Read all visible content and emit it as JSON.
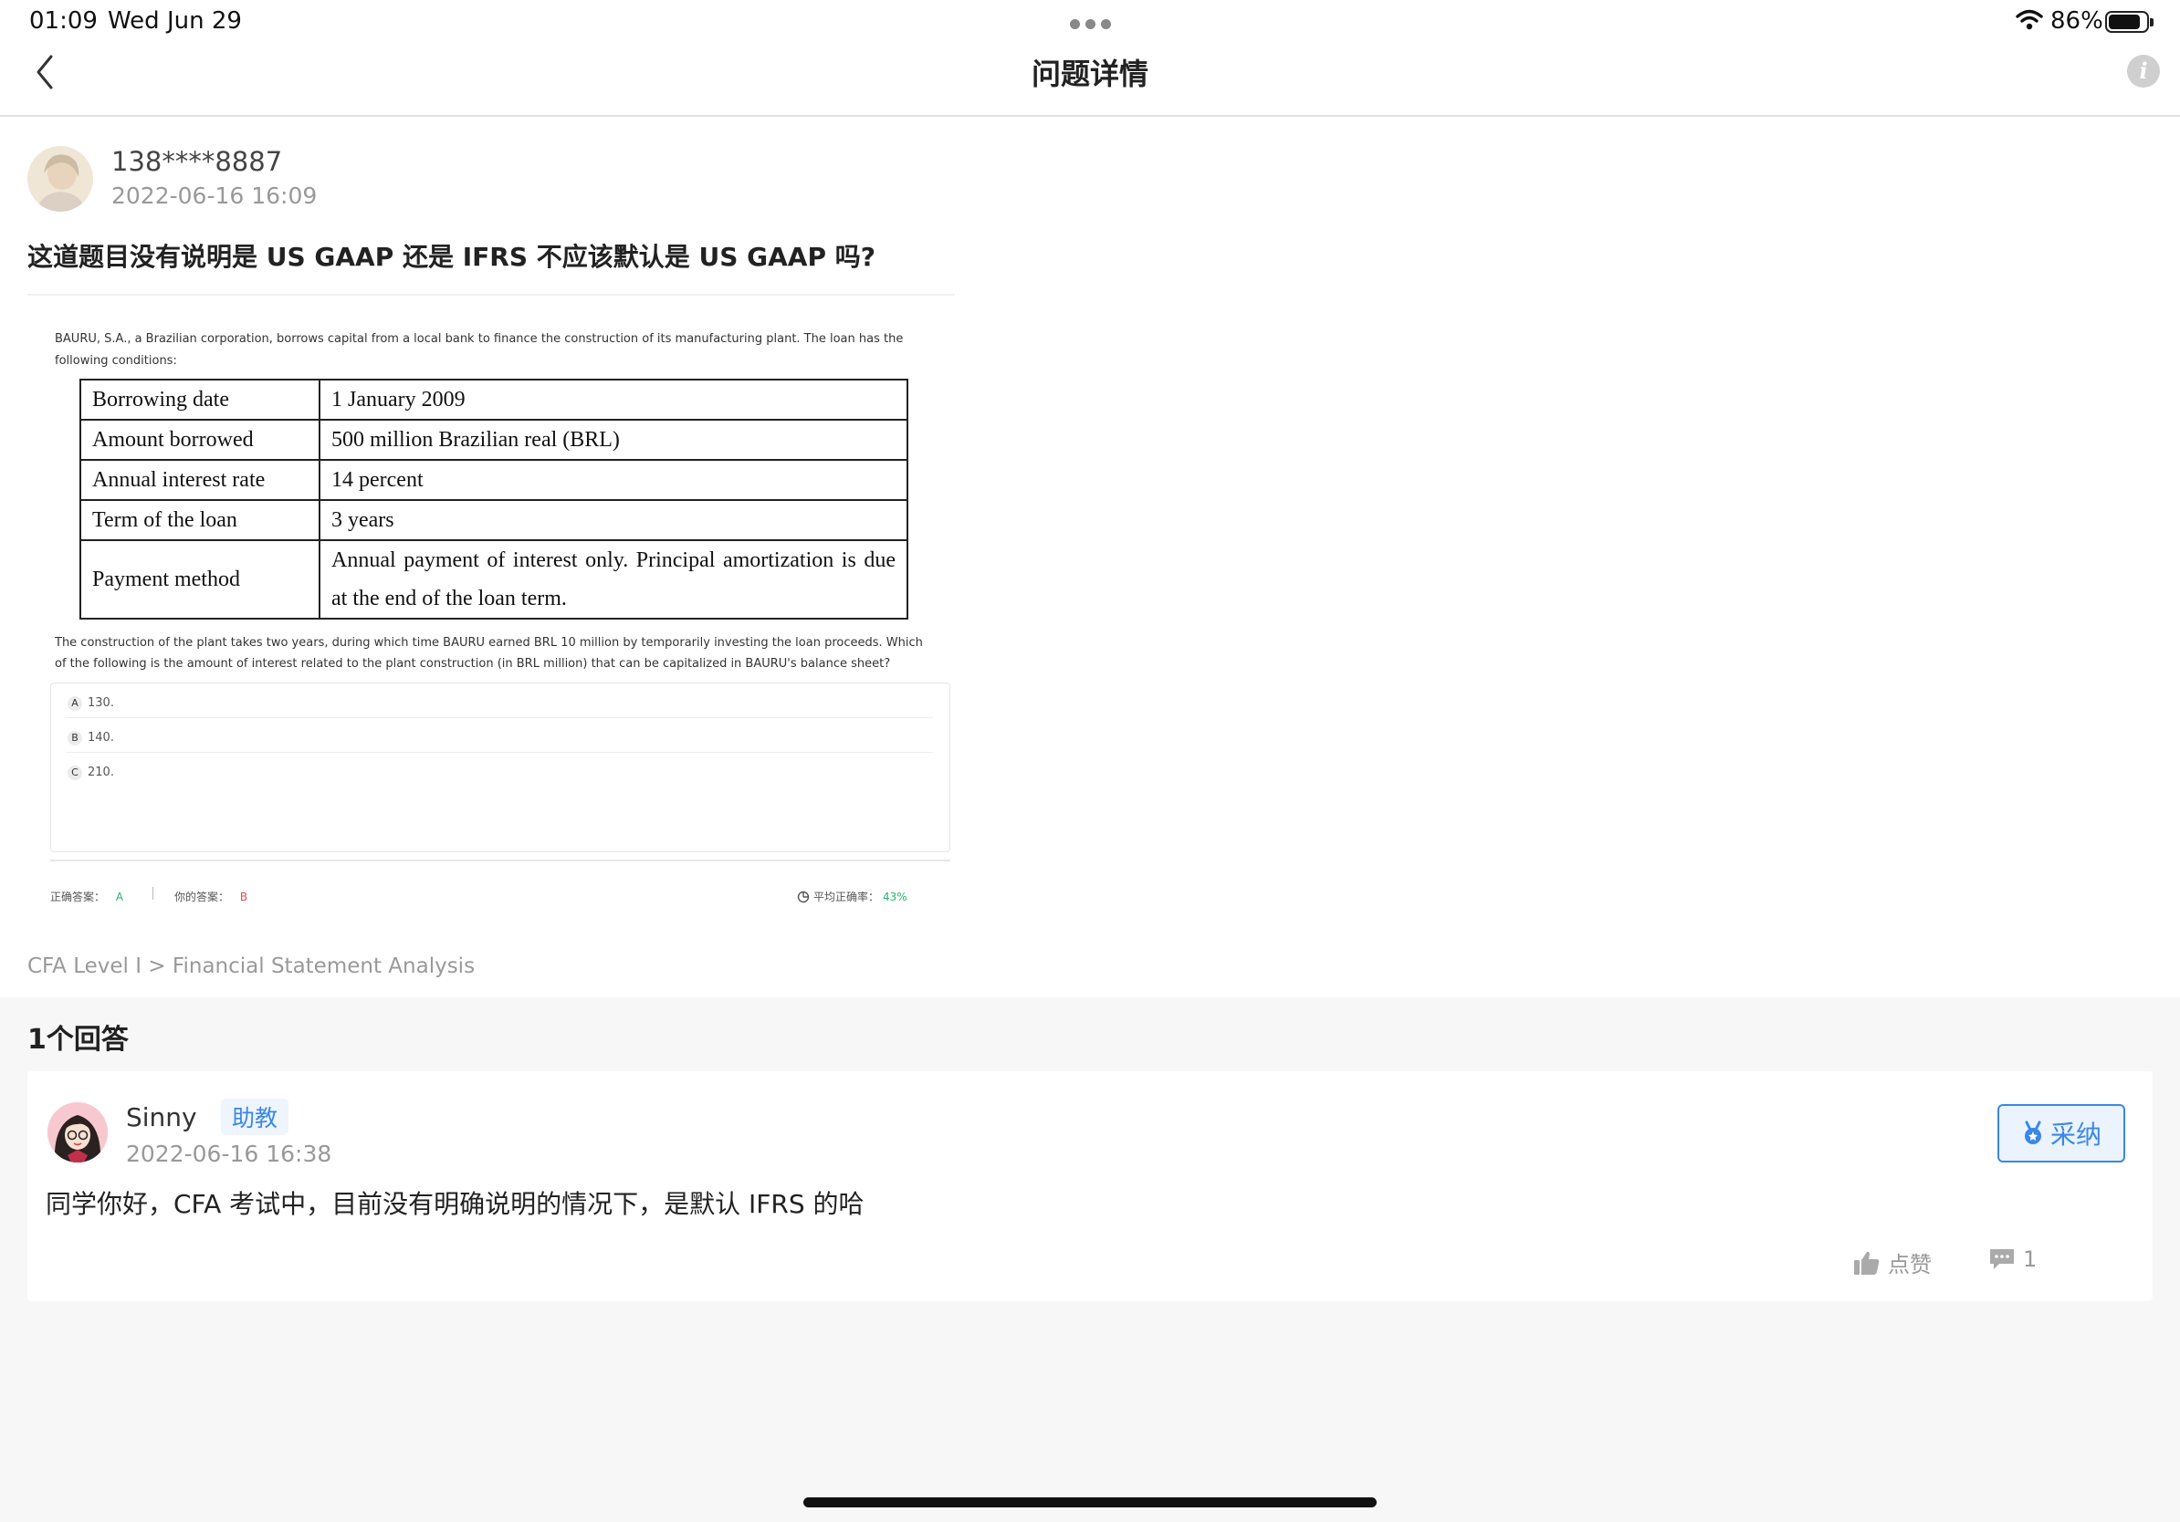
{
  "status_bar": {
    "time": "01:09",
    "date": "Wed Jun 29",
    "battery": "86%"
  },
  "nav": {
    "title": "问题详情"
  },
  "question": {
    "user": "138****8887",
    "time": "2022-06-16 16:09",
    "text": "这道题目没有说明是 US GAAP 还是 IFRS 不应该默认是 US GAAP 吗?",
    "image": {
      "intro": "BAURU, S.A., a Brazilian corporation, borrows capital from a local bank to finance the construction of its manufacturing plant. The loan has the following conditions:",
      "table": [
        {
          "key": "Borrowing date",
          "value": "1 January 2009"
        },
        {
          "key": "Amount borrowed",
          "value": "500 million Brazilian real (BRL)"
        },
        {
          "key": "Annual interest rate",
          "value": "14 percent"
        },
        {
          "key": "Term of the loan",
          "value": "3 years"
        },
        {
          "key": "Payment method",
          "value": "Annual payment of interest only. Principal amortization is due at the end of the loan term."
        }
      ],
      "paragraph": "The construction of the plant takes two years, during which time BAURU earned BRL 10 million by temporarily investing the loan proceeds. Which of the following is the amount of interest related to the plant construction (in BRL million) that can be capitalized in BAURU's balance sheet?",
      "options": [
        {
          "letter": "A",
          "text": "130."
        },
        {
          "letter": "B",
          "text": "140."
        },
        {
          "letter": "C",
          "text": "210."
        }
      ],
      "correct_label": "正确答案：",
      "correct_value": "A",
      "your_label": "你的答案：",
      "your_value": "B",
      "avg_label": "平均正确率：",
      "avg_value": "43%"
    },
    "breadcrumb": "CFA Level I > Financial Statement Analysis"
  },
  "answers": {
    "heading": "1个回答",
    "items": [
      {
        "user": "Sinny",
        "badge": "助教",
        "time": "2022-06-16 16:38",
        "text": "同学你好，CFA 考试中，目前没有明确说明的情况下，是默认 IFRS 的哈",
        "adopt_label": "采纳",
        "like_label": "点赞",
        "comment_count": "1"
      }
    ]
  },
  "colors": {
    "accent": "#3a87e8",
    "correct": "#27b36a",
    "wrong": "#e05050"
  }
}
